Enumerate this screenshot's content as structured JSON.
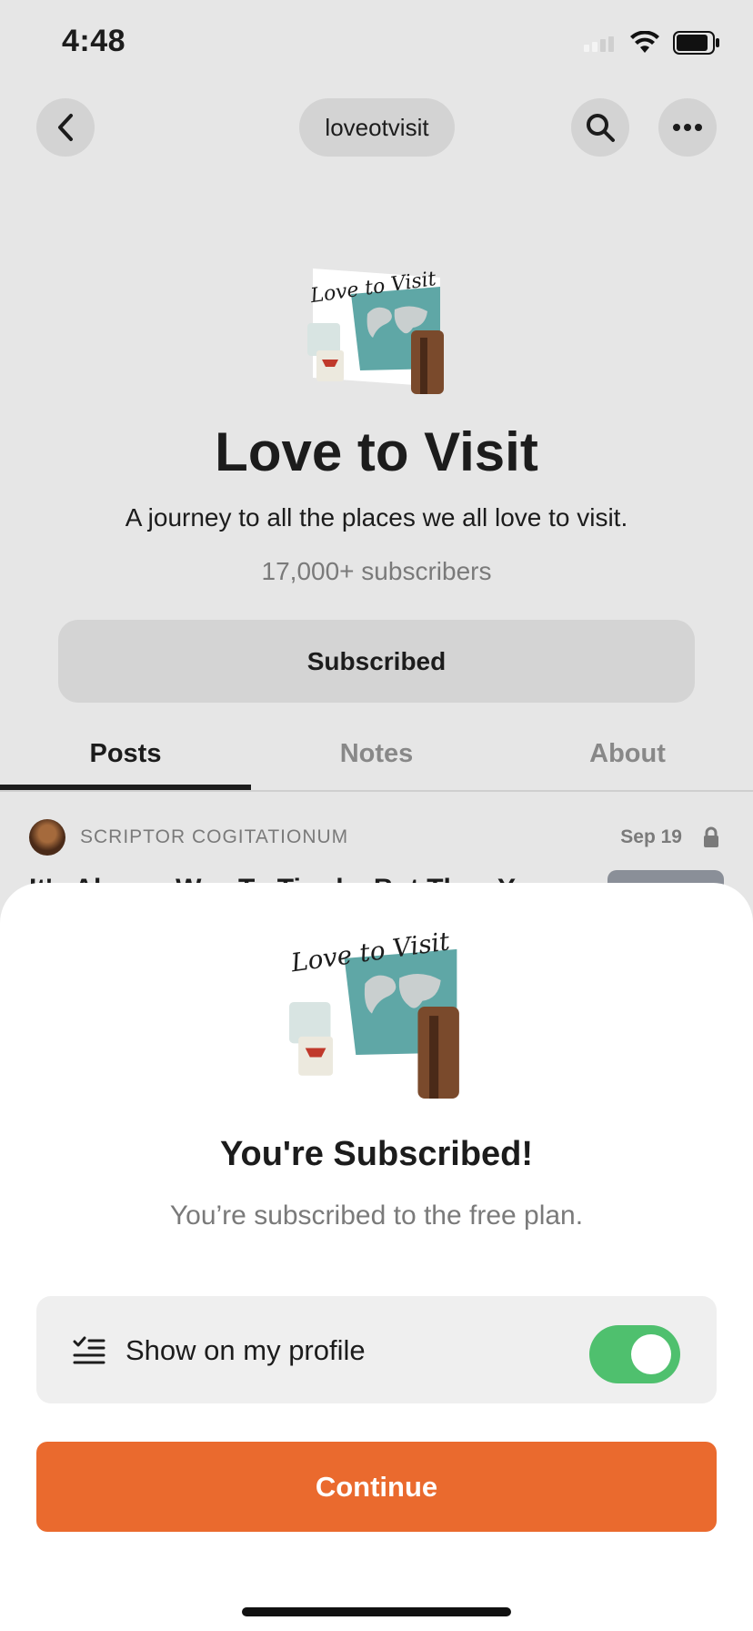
{
  "status_bar": {
    "time": "4:48"
  },
  "nav": {
    "handle": "loveotvisit"
  },
  "publication": {
    "title": "Love to Visit",
    "description": "A journey to all the places we all love to visit.",
    "subscribers": "17,000+ subscribers",
    "subscribe_button": "Subscribed",
    "logo_text": "Love to Visit"
  },
  "tabs": [
    {
      "label": "Posts",
      "active": true
    },
    {
      "label": "Notes",
      "active": false
    },
    {
      "label": "About",
      "active": false
    }
  ],
  "post": {
    "author": "SCRIPTOR COGITATIONUM",
    "date": "Sep 19",
    "title_peek": "It's Always Way To Tired... But They Y..."
  },
  "sheet": {
    "title": "You're Subscribed!",
    "subtitle": "You’re subscribed to the free plan.",
    "toggle_label": "Show on my profile",
    "toggle_on": true,
    "continue_label": "Continue"
  },
  "colors": {
    "accent": "#ea6a2e",
    "toggle_on": "#4fc06e",
    "background": "#e6e6e6"
  },
  "icons": [
    "back-chevron-icon",
    "search-icon",
    "more-icon",
    "lock-icon",
    "list-check-icon",
    "wifi-icon",
    "battery-icon",
    "signal-icon"
  ]
}
